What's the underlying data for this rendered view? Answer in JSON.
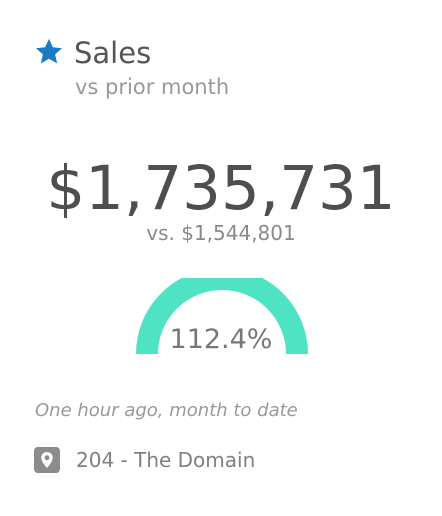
{
  "widget": {
    "title": "Sales",
    "subtitle": "vs prior month",
    "value": "$1,735,731",
    "comparison": "vs. $1,544,801",
    "percent_label": "112.4%",
    "gauge_fraction": 1.0,
    "updated": "One hour ago, month to date",
    "location": "204 - The Domain"
  },
  "colors": {
    "star": "#1a7ac4",
    "gauge": "#4de3c3",
    "location_icon_bg": "#8c8c8c"
  },
  "icons": {
    "favorite": "star-icon",
    "location": "map-pin-icon"
  }
}
